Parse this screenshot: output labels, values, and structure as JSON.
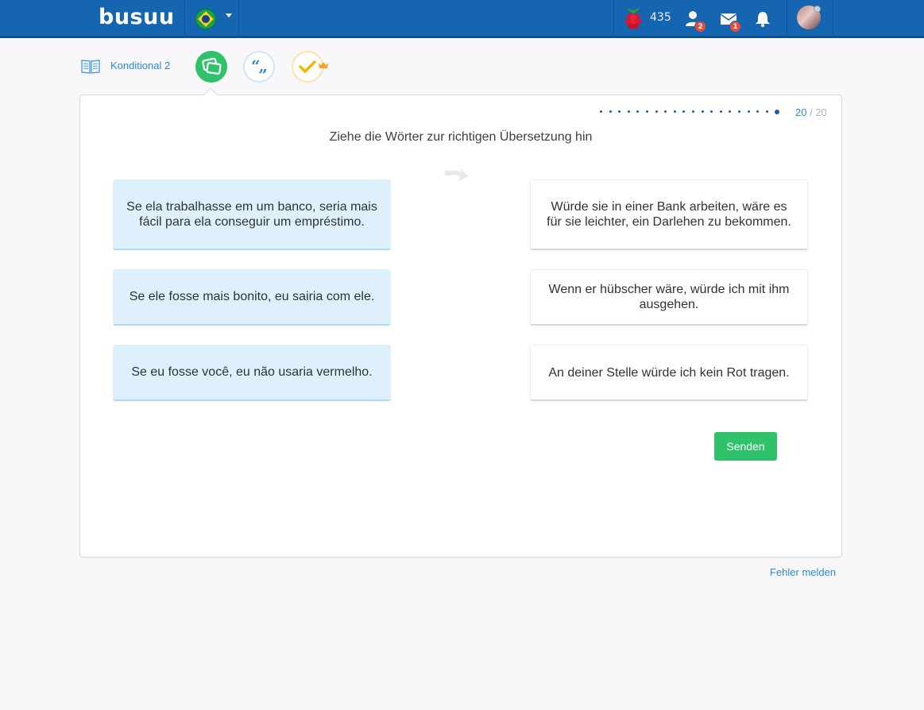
{
  "header": {
    "logo": "busuu",
    "points": "435",
    "friends_badge": "2",
    "messages_badge": "1",
    "icons": [
      "brazil-flag-icon",
      "raspberry-icon",
      "friends-icon",
      "mail-icon",
      "bell-icon",
      "avatar"
    ]
  },
  "lesson": {
    "title": "Konditional 2",
    "steps": [
      "flashcards-icon",
      "quote-icon",
      "checkmark-crown-icon"
    ]
  },
  "exercise": {
    "progress_current": "20",
    "progress_separator": " / ",
    "progress_total": "20",
    "instruction": "Ziehe die Wörter zur richtigen Übersetzung hin",
    "sources": [
      "Se ela trabalhasse em um banco, seria mais fácil para ela conseguir um empréstimo.",
      "Se ele fosse mais bonito, eu sairia com ele.",
      "Se eu fosse você, eu não usaria vermelho."
    ],
    "targets": [
      "Würde sie in einer Bank arbeiten, wäre es für sie leichter, ein Darlehen zu bekommen.",
      "Wenn er hübscher wäre, würde ich mit ihm ausgehen.",
      "An deiner Stelle würde ich kein Rot tragen."
    ],
    "submit_label": "Senden"
  },
  "footer": {
    "report_label": "Fehler melden"
  },
  "colors": {
    "header_blue": "#1565b0",
    "accent_green": "#2fc26b",
    "link_blue": "#2b88d8",
    "source_tile": "#dff0fd"
  }
}
